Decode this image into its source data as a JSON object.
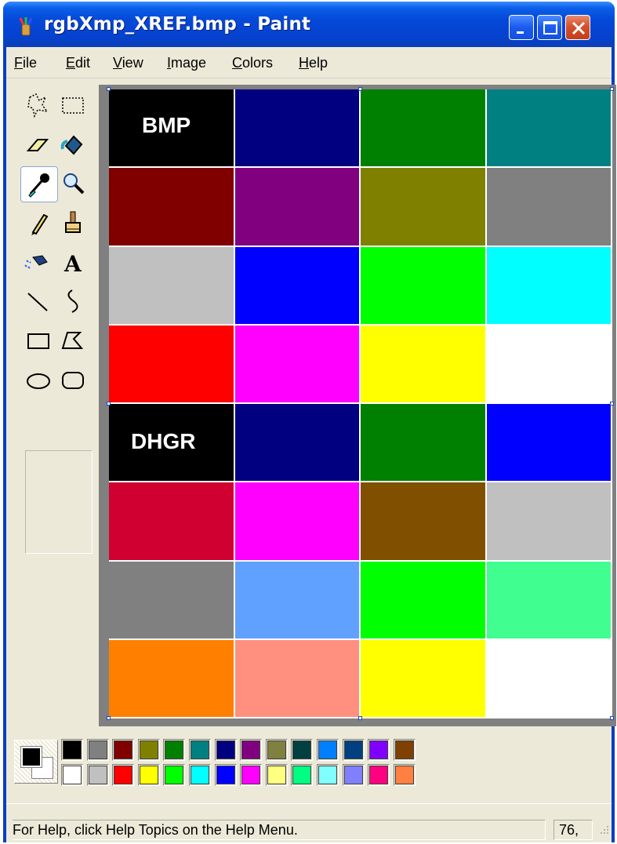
{
  "window": {
    "title": "rgbXmp_XREF.bmp - Paint",
    "buttons": {
      "minimize": "minimize-icon",
      "maximize": "maximize-icon",
      "close": "close-icon"
    }
  },
  "menu": [
    "File",
    "Edit",
    "View",
    "Image",
    "Colors",
    "Help"
  ],
  "menu_underline": [
    "F",
    "E",
    "V",
    "I",
    "C",
    "H"
  ],
  "tools": [
    "free-form-select-icon",
    "rect-select-icon",
    "eraser-icon",
    "fill-bucket-icon",
    "color-picker-icon",
    "magnifier-icon",
    "pencil-icon",
    "brush-icon",
    "airbrush-icon",
    "text-icon",
    "line-icon",
    "curve-icon",
    "rectangle-icon",
    "polygon-icon",
    "ellipse-icon",
    "rounded-rect-icon"
  ],
  "selected_tool": "color-picker-icon",
  "canvas": {
    "labels": {
      "bmp": "BMP",
      "dhgr": "DHGR"
    },
    "grid": [
      [
        "#000000",
        "#000080",
        "#008000",
        "#008080"
      ],
      [
        "#800000",
        "#800080",
        "#808000",
        "#808080"
      ],
      [
        "#c0c0c0",
        "#0000ff",
        "#00ff00",
        "#00ffff"
      ],
      [
        "#ff0000",
        "#ff00ff",
        "#ffff00",
        "#ffffff"
      ],
      [
        "#000000",
        "#000080",
        "#008000",
        "#0000ff"
      ],
      [
        "#d00030",
        "#ff00ff",
        "#805000",
        "#c0c0c0"
      ],
      [
        "#808080",
        "#60a0ff",
        "#00ff00",
        "#40ff90"
      ],
      [
        "#ff8000",
        "#ff9080",
        "#ffff00",
        "#ffffff"
      ]
    ]
  },
  "palette": {
    "foreground": "#000000",
    "background": "#ffffff",
    "top": [
      "#000000",
      "#808080",
      "#800000",
      "#808000",
      "#008000",
      "#008080",
      "#000080",
      "#800080",
      "#808040",
      "#004040",
      "#0080ff",
      "#004080",
      "#8000ff",
      "#804000"
    ],
    "bottom": [
      "#ffffff",
      "#c0c0c0",
      "#ff0000",
      "#ffff00",
      "#00ff00",
      "#00ffff",
      "#0000ff",
      "#ff00ff",
      "#ffff80",
      "#00ff80",
      "#80ffff",
      "#8080ff",
      "#ff0080",
      "#ff8040"
    ]
  },
  "status": {
    "help": "For Help, click Help Topics on the Help Menu.",
    "coords": "76,"
  }
}
